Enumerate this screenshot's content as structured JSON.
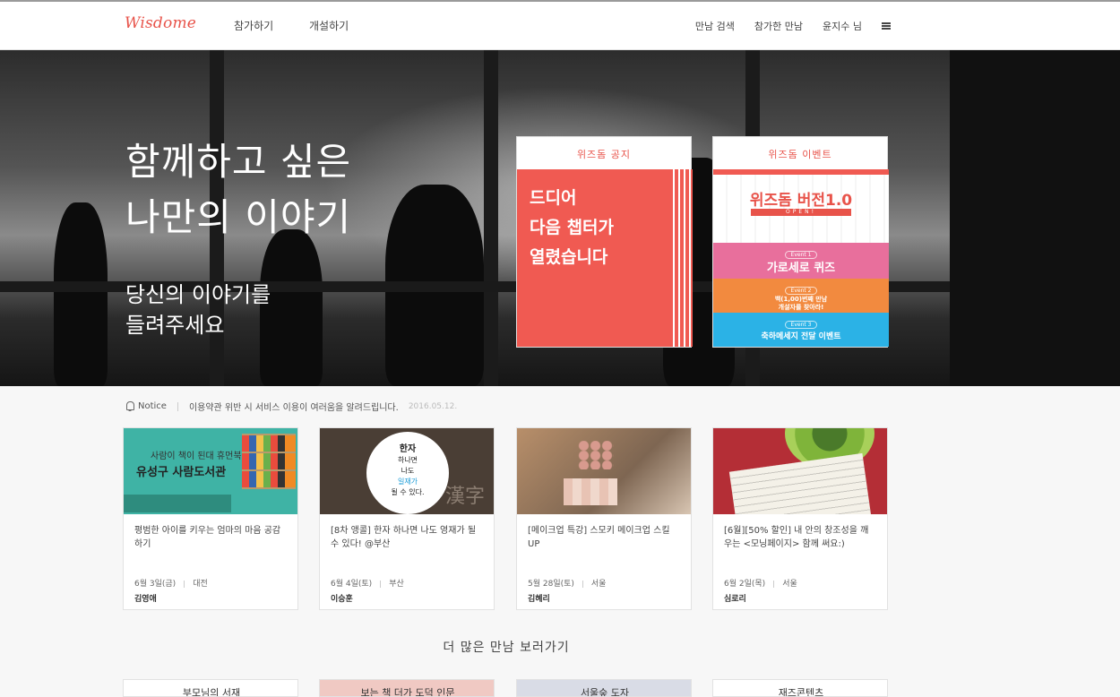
{
  "header": {
    "logo": "Wisdome",
    "nav": [
      "참가하기",
      "개설하기"
    ],
    "right": [
      "만남 검색",
      "참가한 만남",
      "윤지수 님"
    ]
  },
  "hero": {
    "title_line1": "함께하고 싶은",
    "title_line2": "나만의 이야기",
    "sub_line1": "당신의 이야기를",
    "sub_line2": "들려주세요"
  },
  "notice_card": {
    "header": "위즈돔 공지",
    "lines": [
      "드디어",
      "다음 챕터가",
      "열렸습니다"
    ]
  },
  "event_card": {
    "header": "위즈돔 이벤트",
    "title": "위즈돔 버전1.0",
    "ribbon": "OPEN!",
    "event1_tag": "Event 1",
    "event1": "가로세로 퀴즈",
    "event2_tag": "Event 2",
    "event2_line1": "백(1,00)번째 만남",
    "event2_line2": "개설자를 찾아라!",
    "event3_tag": "Event 3",
    "event3": "축하메세지 전달 이벤트"
  },
  "notice_bar": {
    "label": "Notice",
    "text": "이용약관 위반 시 서비스 이용이 여러움을 알려드립니다.",
    "date": "2016.05.12."
  },
  "meetings": [
    {
      "thumb_line1": "사람이 책이 된대 휴먼북",
      "thumb_line2": "유성구 사람도서관",
      "title": "평범한 아이를 키우는 엄마의 마음 공감하기",
      "date": "6월 3일(금)",
      "place": "대전",
      "host": "김영애"
    },
    {
      "thumb_circle_1": "한자",
      "thumb_circle_2": "하나면",
      "thumb_circle_3": "나도",
      "thumb_circle_4": "일재가",
      "thumb_circle_5": "될 수 있다.",
      "thumb_han": "漢字",
      "title": "[8차 앵콜] 한자 하나면 나도 영재가 될 수 있다! @부산",
      "date": "6월 4일(토)",
      "place": "부산",
      "host": "이승훈"
    },
    {
      "title": "[메이크업 특강] 스모키 메이크업 스킬 UP",
      "date": "5월 28일(토)",
      "place": "서울",
      "host": "김혜리"
    },
    {
      "title": "[6월][50% 할인] 내 안의 창조성을 깨우는 <모닝페이지> 함께 써요:)",
      "date": "6월 2일(목)",
      "place": "서울",
      "host": "심로리"
    }
  ],
  "more": {
    "title": "더 많은 만남 보러가기",
    "peek": [
      "부모님의 서재",
      "보는 책 더가 도덕 인문",
      "서울숲 도자",
      "재즈콘텐츠"
    ]
  }
}
